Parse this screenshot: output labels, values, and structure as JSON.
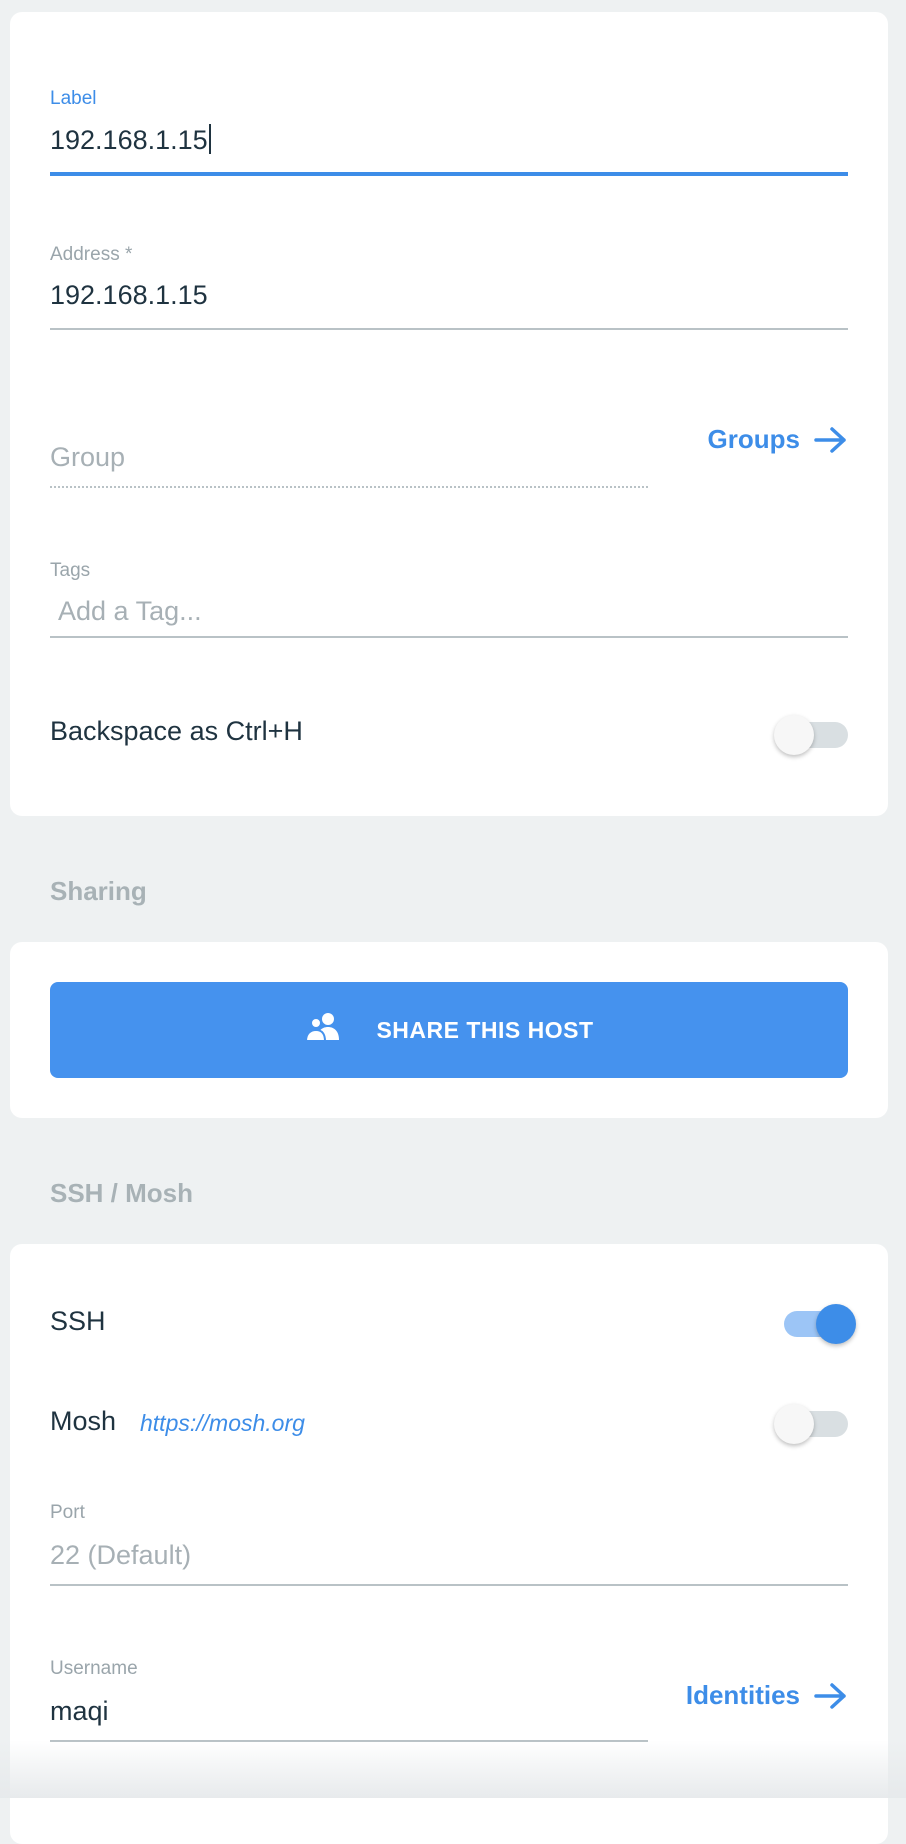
{
  "general": {
    "label_field": {
      "label": "Label",
      "value": "192.168.1.15"
    },
    "address_field": {
      "label": "Address *",
      "value": "192.168.1.15"
    },
    "group_field": {
      "placeholder": "Group",
      "link": "Groups"
    },
    "tags_field": {
      "label": "Tags",
      "placeholder": "Add a Tag..."
    },
    "backspace_toggle": {
      "label": "Backspace as Ctrl+H",
      "on": false
    }
  },
  "sharing": {
    "title": "Sharing",
    "share_button": "SHARE THIS HOST",
    "share_icon": "users-icon"
  },
  "ssh_mosh": {
    "title": "SSH / Mosh",
    "ssh_toggle": {
      "label": "SSH",
      "on": true
    },
    "mosh_toggle": {
      "label": "Mosh",
      "link": "https://mosh.org",
      "on": false
    },
    "port_field": {
      "label": "Port",
      "placeholder": "22 (Default)"
    },
    "username_field": {
      "label": "Username",
      "value": "maqi",
      "link": "Identities"
    }
  },
  "colors": {
    "accent": "#3d8de8",
    "button": "#4592ee",
    "background": "#eef1f2"
  }
}
